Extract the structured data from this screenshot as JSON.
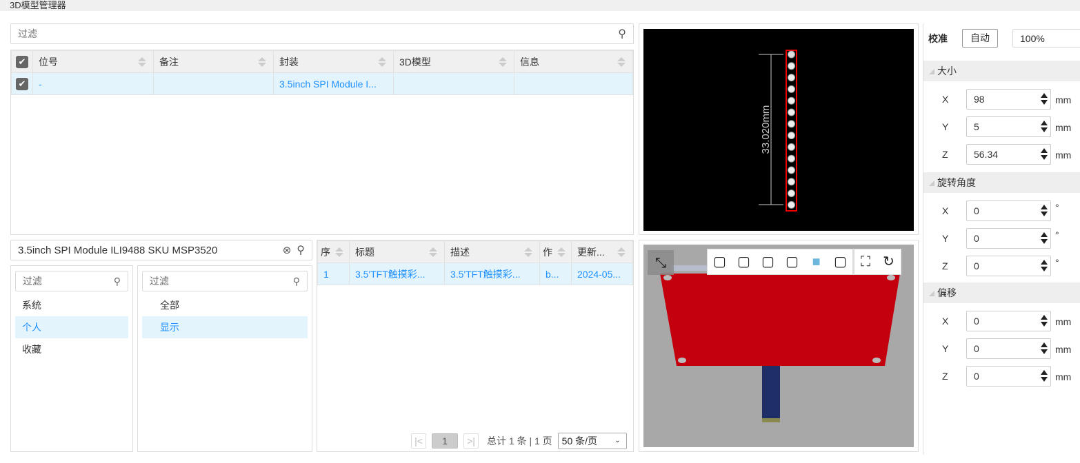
{
  "title": "3D模型管理器",
  "filter_placeholder": "过滤",
  "top_table": {
    "headers": [
      "位号",
      "备注",
      "封装",
      "3D模型",
      "信息"
    ],
    "rows": [
      [
        "-",
        "",
        "3.5inch SPI Module I...",
        "",
        ""
      ]
    ]
  },
  "preview": {
    "dimension": "33.020mm"
  },
  "search": {
    "value": "3.5inch SPI Module ILI9488 SKU MSP3520"
  },
  "left_list": {
    "placeholder": "过滤",
    "items": [
      "系统",
      "个人",
      "收藏"
    ],
    "selected": 1
  },
  "mid_list": {
    "placeholder": "过滤",
    "items": [
      "全部",
      "显示"
    ],
    "selected": 1
  },
  "model_table": {
    "headers": [
      "序",
      "标题",
      "描述",
      "作",
      "更新..."
    ],
    "rows": [
      [
        "1",
        "3.5'TFT触摸彩...",
        "3.5'TFT触摸彩...",
        "b...",
        "2024-05..."
      ]
    ]
  },
  "pagination": {
    "page": "1",
    "summary": "总计 1 条 | 1 页",
    "page_size": "50 条/页"
  },
  "view_icons": [
    "view-front-icon",
    "view-back-icon",
    "view-left-icon",
    "view-right-icon",
    "view-top-icon",
    "view-bottom-icon",
    "fit-view-icon",
    "reset-rotate-icon"
  ],
  "right": {
    "calibrate_label": "校准",
    "auto_label": "自动",
    "scale": "100%",
    "size": {
      "title": "大小",
      "x": "98",
      "y": "5",
      "z": "56.34",
      "unit": "mm"
    },
    "rotation": {
      "title": "旋转角度",
      "x": "0",
      "y": "0",
      "z": "0",
      "unit": "°"
    },
    "offset": {
      "title": "偏移",
      "x": "0",
      "y": "0",
      "z": "0",
      "unit": "mm"
    },
    "axis": {
      "x": "X",
      "y": "Y",
      "z": "Z"
    }
  },
  "colors": {
    "accent": "#1e90ff",
    "pcb": "#c4000f",
    "selected_bg": "#e4f4fd"
  }
}
